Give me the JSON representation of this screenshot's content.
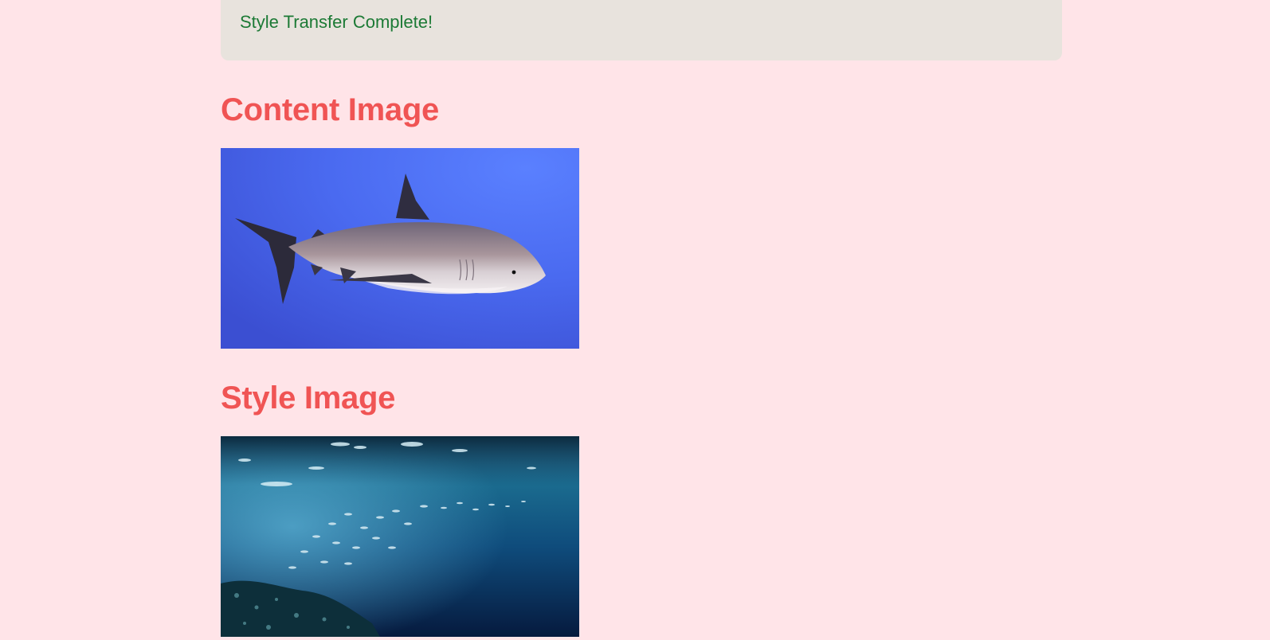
{
  "alert": {
    "message": "Style Transfer Complete!",
    "status_color": "#1c7a35",
    "background": "#e8e3dd"
  },
  "sections": [
    {
      "heading": "Content Image",
      "image": "shark-photo"
    },
    {
      "heading": "Style Image",
      "image": "underwater-fish-school-photo"
    }
  ],
  "colors": {
    "page_background": "#ffe4e8",
    "heading": "#f05454"
  }
}
